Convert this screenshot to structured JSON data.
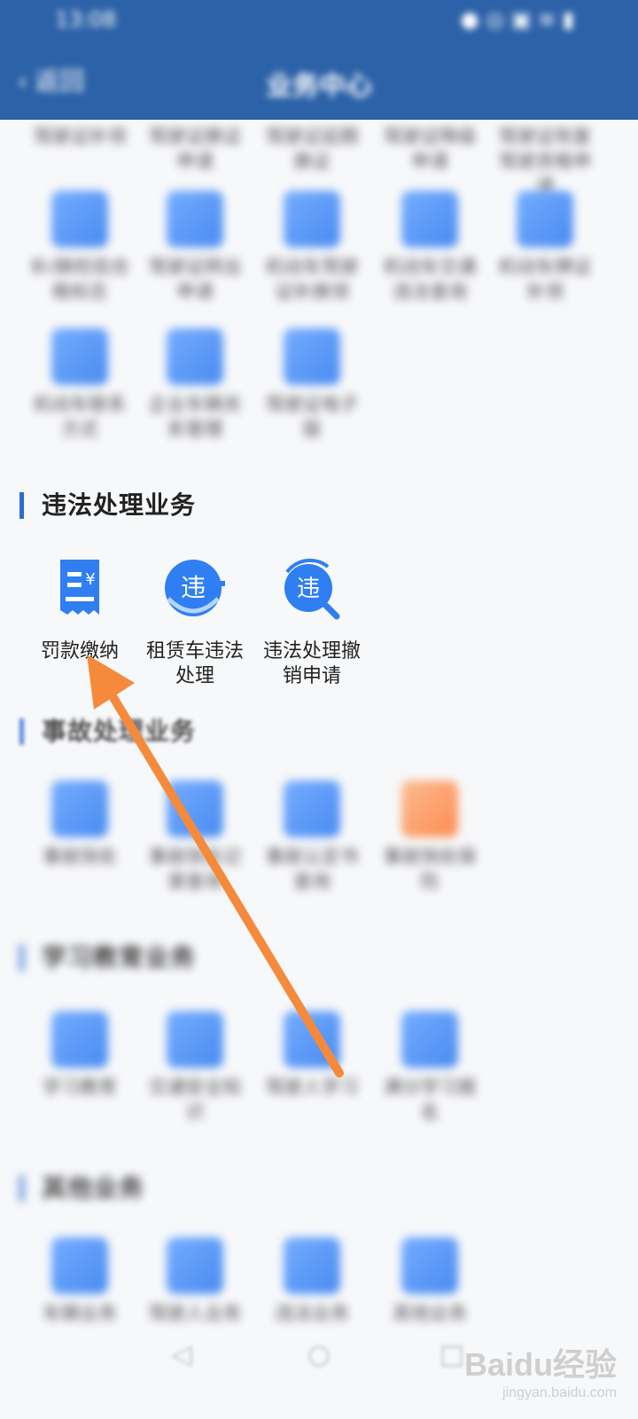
{
  "status_bar": {
    "time": "13:08",
    "icons": "● ◎ ▣ ≋ ▮"
  },
  "header": {
    "back_label": "返回",
    "back_icon": "‹",
    "title": "业务中心"
  },
  "top_rows": {
    "row1": [
      "驾驶证补领",
      "驾驶证换证申请",
      "驾驶证延期换证",
      "驾驶证降级申请",
      "驾驶证恢复驾驶资格申请"
    ],
    "row2": [
      "补/换检验合格标志",
      "驾驶证转出申请",
      "机动车驾驶证补换领",
      "机动车交通违法查询",
      "机动车牌证补领"
    ],
    "row3": [
      "机动车联系方式",
      "企业车辆关系管理",
      "驾驶证电子版"
    ]
  },
  "violation_section": {
    "title": "违法处理业务",
    "items": [
      {
        "label": "罚款缴纳",
        "icon": "receipt-icon"
      },
      {
        "label": "租赁车违法处理",
        "icon": "violation-badge-icon"
      },
      {
        "label": "违法处理撤销申请",
        "icon": "violation-search-icon"
      }
    ]
  },
  "accident_section": {
    "title": "事故处理业务",
    "items": [
      "事故快处",
      "事故快处记录查询",
      "事故认定书查询",
      "事故快处保险"
    ]
  },
  "study_section": {
    "title": "学习教育业务",
    "items": [
      "学习教育",
      "交通安全知识",
      "驾驶人学习",
      "满分学习报名"
    ]
  },
  "other_section": {
    "title": "其他业务",
    "items": [
      "车辆业务",
      "驾驶人业务",
      "违法业务",
      "其他业务"
    ]
  },
  "bottom_nav": {
    "back": "◁",
    "home": "○",
    "recent": "□"
  },
  "watermark": {
    "brand": "Baidu经验",
    "domain": "jingyan.baidu.com"
  },
  "colors": {
    "header": "#2c62a8",
    "accent": "#2f6bd3",
    "icon_blue": "#2b78f0",
    "arrow": "#f58a3c"
  }
}
